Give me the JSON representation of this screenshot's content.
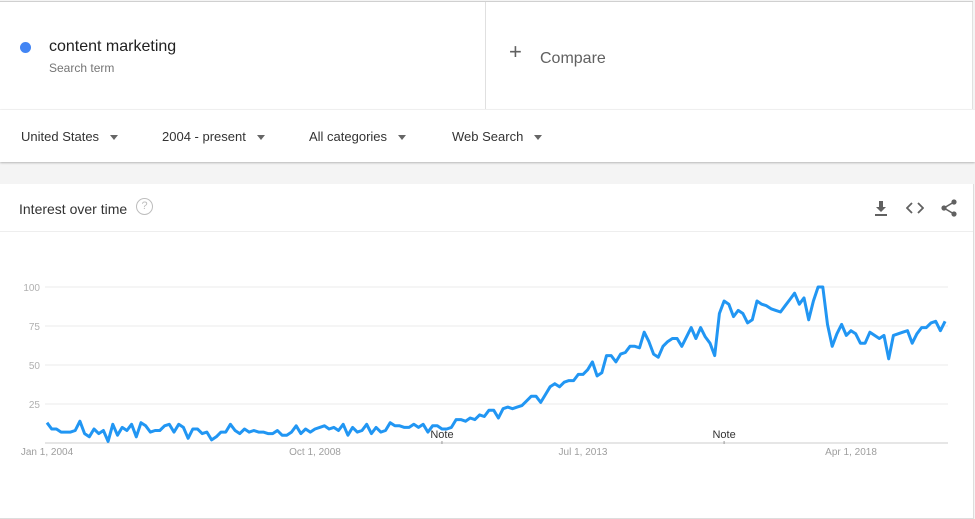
{
  "search_term": {
    "name": "content marketing",
    "subtitle": "Search term",
    "color": "#4285f4"
  },
  "compare": {
    "icon": "plus-icon",
    "label": "Compare"
  },
  "filters": {
    "region": "United States",
    "time_range": "2004 - present",
    "category": "All categories",
    "search_type": "Web Search"
  },
  "panel": {
    "title": "Interest over time",
    "help_icon": "?",
    "actions": [
      "download-icon",
      "embed-icon",
      "share-icon"
    ]
  },
  "chart_data": {
    "type": "line",
    "title": "Interest over time",
    "xlabel": "",
    "ylabel": "",
    "ylim": [
      0,
      100
    ],
    "yticks": [
      25,
      50,
      75,
      100
    ],
    "xtick_labels": [
      "Jan 1, 2004",
      "Oct 1, 2008",
      "Jul 1, 2013",
      "Apr 1, 2018"
    ],
    "xtick_month_index": [
      0,
      57,
      114,
      171
    ],
    "annotations": [
      {
        "label": "Note",
        "month_index": 84
      },
      {
        "label": "Note",
        "month_index": 144
      }
    ],
    "grid": true,
    "series": [
      {
        "name": "content marketing",
        "color": "#2196f3",
        "start": "2004-01",
        "frequency": "monthly",
        "values": [
          13,
          9,
          9,
          7,
          7,
          7,
          8,
          14,
          6,
          4,
          9,
          6,
          8,
          1,
          12,
          5,
          10,
          8,
          12,
          4,
          13,
          11,
          7,
          8,
          8,
          11,
          12,
          7,
          12,
          10,
          3,
          9,
          9,
          6,
          7,
          2,
          4,
          7,
          7,
          12,
          8,
          6,
          9,
          7,
          8,
          7,
          7,
          6,
          6,
          8,
          5,
          5,
          7,
          11,
          6,
          9,
          7,
          9,
          10,
          11,
          9,
          10,
          8,
          12,
          5,
          10,
          7,
          8,
          12,
          6,
          10,
          7,
          8,
          13,
          11,
          11,
          10,
          10,
          12,
          10,
          12,
          7,
          11,
          11,
          9,
          9,
          10,
          15,
          15,
          14,
          16,
          15,
          18,
          17,
          21,
          21,
          16,
          22,
          23,
          22,
          23,
          24,
          27,
          30,
          30,
          26,
          31,
          36,
          38,
          36,
          39,
          40,
          40,
          44,
          44,
          47,
          52,
          43,
          45,
          56,
          56,
          52,
          57,
          58,
          62,
          62,
          61,
          71,
          65,
          57,
          55,
          62,
          65,
          67,
          67,
          62,
          68,
          74,
          67,
          74,
          68,
          64,
          56,
          83,
          91,
          89,
          81,
          85,
          83,
          77,
          79,
          91,
          89,
          88,
          86,
          85,
          84,
          88,
          92,
          96,
          89,
          93,
          79,
          91,
          100,
          100,
          76,
          62,
          70,
          76,
          69,
          72,
          70,
          64,
          64,
          71,
          69,
          67,
          69,
          54,
          69,
          70,
          71,
          72,
          64,
          70,
          74,
          74,
          77,
          78,
          72,
          78
        ]
      }
    ]
  }
}
